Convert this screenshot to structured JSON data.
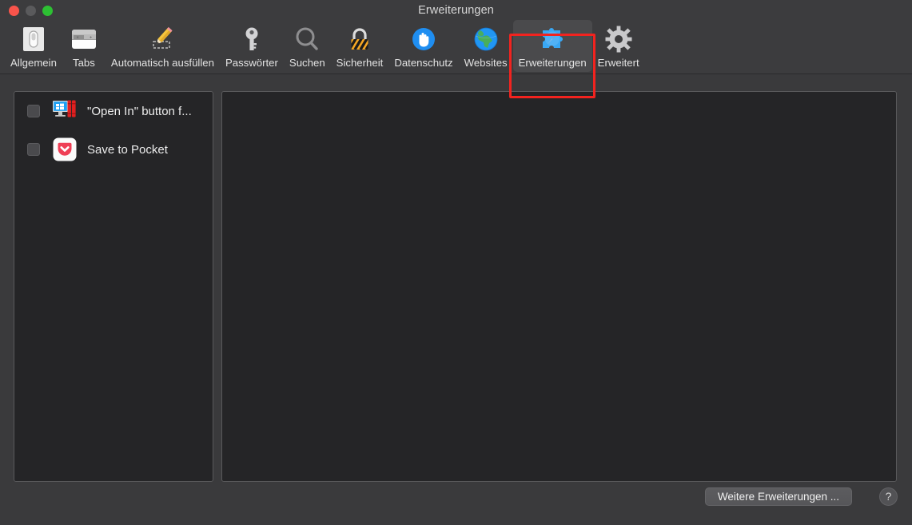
{
  "window": {
    "title": "Erweiterungen",
    "controls": {
      "close": "close-button",
      "minimize": "minimize-button",
      "zoom": "zoom-button"
    }
  },
  "toolbar": {
    "items": [
      {
        "label": "Allgemein",
        "icon": "switch-icon",
        "selected": false
      },
      {
        "label": "Tabs",
        "icon": "tabs-icon",
        "selected": false
      },
      {
        "label": "Automatisch ausfüllen",
        "icon": "pencil-icon",
        "selected": false
      },
      {
        "label": "Passwörter",
        "icon": "key-icon",
        "selected": false
      },
      {
        "label": "Suchen",
        "icon": "magnifier-icon",
        "selected": false
      },
      {
        "label": "Sicherheit",
        "icon": "padlock-icon",
        "selected": false
      },
      {
        "label": "Datenschutz",
        "icon": "hand-icon",
        "selected": false
      },
      {
        "label": "Websites",
        "icon": "globe-icon",
        "selected": false
      },
      {
        "label": "Erweiterungen",
        "icon": "puzzle-compass-icon",
        "selected": true
      },
      {
        "label": "Erweitert",
        "icon": "gear-icon",
        "selected": false
      }
    ],
    "highlight_color": "#f2231f"
  },
  "sidebar": {
    "extensions": [
      {
        "name": "\"Open In\" button f...",
        "icon": "parallels-open-in-icon",
        "checked": false
      },
      {
        "name": "Save to Pocket",
        "icon": "pocket-icon",
        "checked": false
      }
    ]
  },
  "detail": {
    "content": ""
  },
  "footer": {
    "more_extensions_label": "Weitere Erweiterungen ...",
    "help_label": "?"
  }
}
